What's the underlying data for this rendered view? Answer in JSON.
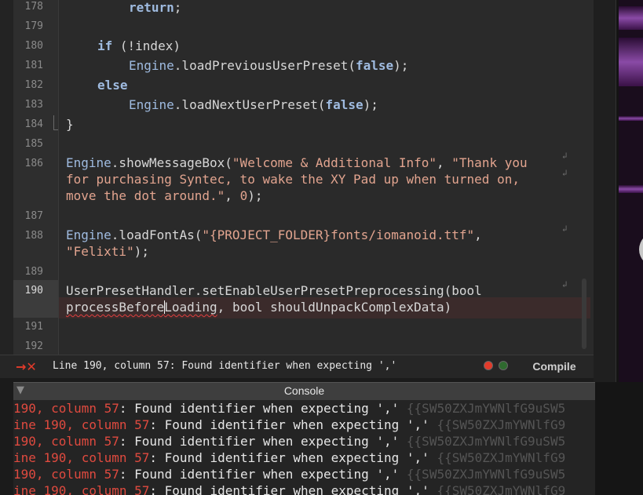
{
  "editor": {
    "line_numbers": [
      "178",
      "179",
      "180",
      "181",
      "182",
      "183",
      "184",
      "185",
      "186",
      "187",
      "188",
      "189",
      "190",
      "191",
      "192"
    ],
    "code": {
      "l178": {
        "kw_return": "return",
        "semi": ";"
      },
      "l180": {
        "kw_if": "if",
        "rest": " (!index)"
      },
      "l181": {
        "obj": "Engine",
        "method": ".loadPreviousUserPreset(",
        "kw_false": "false",
        "end": ");"
      },
      "l182": {
        "kw_else": "else"
      },
      "l183": {
        "obj": "Engine",
        "method": ".loadNextUserPreset(",
        "kw_false": "false",
        "end": ");"
      },
      "l184": {
        "brace": "}"
      },
      "l186": {
        "obj": "Engine",
        "method": ".showMessageBox(",
        "str1": "\"Welcome & Additional Info\"",
        "sep": ", ",
        "str2a": "\"Thank you",
        "str2b": "for purchasing Syntec, to wake the XY Pad up when turned on,",
        "str2c": "move the dot around.\"",
        "sep2": ", ",
        "num": "0",
        "end": ");"
      },
      "l188": {
        "obj": "Engine",
        "method": ".loadFontAs(",
        "str1": "\"{PROJECT_FOLDER}fonts/iomanoid.ttf\"",
        "sep": ",",
        "str2": "\"Felixti\"",
        "end": ");"
      },
      "l190": {
        "line1": "UserPresetHandler.setEnableUserPresetPreprocessing(bool",
        "err_a": "processBefore",
        "err_b": "Loading",
        "rest": ", bool shouldUnpackComplexData)"
      }
    },
    "wrap_icon": "↲"
  },
  "status_bar": {
    "error_icon": "→✕",
    "message": "Line 190, column 57: Found identifier when expecting ','",
    "compile_label": "Compile"
  },
  "console": {
    "collapse_icon": "▼",
    "title": "Console",
    "lines": [
      {
        "loc": "190, column 57",
        "msg": ": Found identifier when expecting ','",
        "id": " {{SW50ZXJmYWNlfG9uSW5"
      },
      {
        "loc": "ine 190, column 57",
        "msg": ": Found identifier when expecting ','",
        "id": " {{SW50ZXJmYWNlfG9"
      },
      {
        "loc": "190, column 57",
        "msg": ": Found identifier when expecting ','",
        "id": " {{SW50ZXJmYWNlfG9uSW5"
      },
      {
        "loc": "ine 190, column 57",
        "msg": ": Found identifier when expecting ','",
        "id": " {{SW50ZXJmYWNlfG9"
      },
      {
        "loc": "190, column 57",
        "msg": ": Found identifier when expecting ','",
        "id": " {{SW50ZXJmYWNlfG9uSW5"
      },
      {
        "loc": "ine 190, column 57",
        "msg": ": Found identifier when expecting ','",
        "id": " {{SW50ZXJmYWNlfG9"
      }
    ]
  },
  "colors": {
    "keyword": "#9fbbe0",
    "string": "#e2a48f",
    "error": "#e04a3f",
    "console_id": "#555555"
  }
}
